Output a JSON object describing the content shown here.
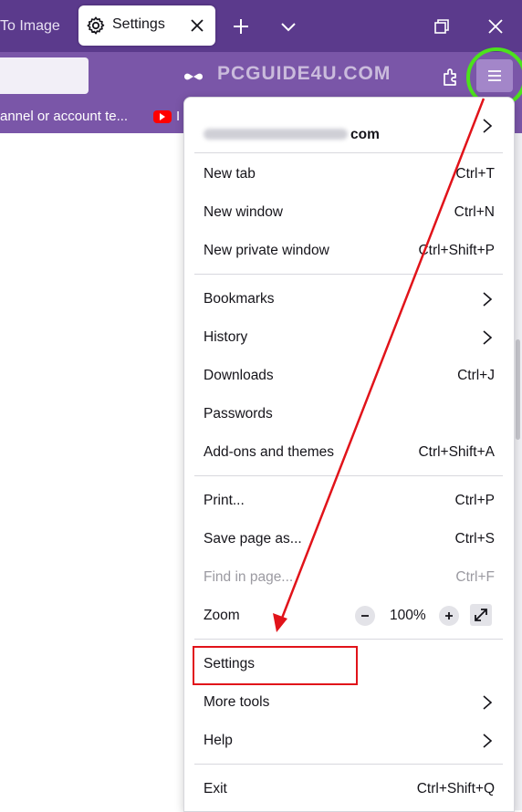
{
  "tabs": {
    "inactive_label": "To Image",
    "active_label": "Settings"
  },
  "watermark": "PCGUIDE4U.COM",
  "bookmarks": {
    "item1": "annel or account te...",
    "item2": "I"
  },
  "menu": {
    "account_suffix": "com",
    "items": [
      {
        "label": "New tab",
        "shortcut": "Ctrl+T"
      },
      {
        "label": "New window",
        "shortcut": "Ctrl+N"
      },
      {
        "label": "New private window",
        "shortcut": "Ctrl+Shift+P"
      },
      {
        "label": "Bookmarks"
      },
      {
        "label": "History"
      },
      {
        "label": "Downloads",
        "shortcut": "Ctrl+J"
      },
      {
        "label": "Passwords"
      },
      {
        "label": "Add-ons and themes",
        "shortcut": "Ctrl+Shift+A"
      },
      {
        "label": "Print...",
        "shortcut": "Ctrl+P"
      },
      {
        "label": "Save page as...",
        "shortcut": "Ctrl+S"
      },
      {
        "label": "Find in page...",
        "shortcut": "Ctrl+F",
        "disabled": true
      },
      {
        "label": "Zoom",
        "value": "100%"
      },
      {
        "label": "Settings"
      },
      {
        "label": "More tools"
      },
      {
        "label": "Help"
      },
      {
        "label": "Exit",
        "shortcut": "Ctrl+Shift+Q"
      }
    ]
  },
  "icons": {
    "tab_settings": "gear-icon",
    "tab_close": "close-icon",
    "new_tab": "plus-icon",
    "tab_list": "chevron-down-icon",
    "restore": "restore-icon",
    "window_close": "close-icon",
    "private": "mask-icon",
    "extensions": "puzzle-icon",
    "app_menu": "hamburger-icon",
    "youtube": "youtube-icon"
  },
  "colors": {
    "tabbar": "#5b3a8c",
    "toolbar": "#7a56a8",
    "highlight_circle": "#4ce21c",
    "annotation_red": "#e1131a"
  }
}
